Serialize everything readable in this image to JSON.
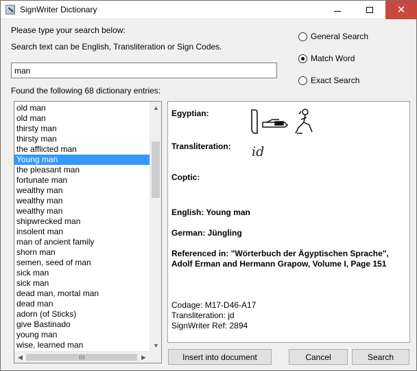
{
  "window": {
    "title": "SignWriter Dictionary"
  },
  "titlebar_buttons": {
    "minimize": "minimize-icon",
    "maximize": "maximize-icon",
    "close": "close-icon"
  },
  "search": {
    "prompt": "Please type your search below:",
    "hint": "Search text can be English, Transliteration or Sign Codes.",
    "value": "man",
    "results_label": "Found the following 68 dictionary entries:"
  },
  "search_modes": [
    {
      "label": "General Search",
      "checked": false
    },
    {
      "label": "Match Word",
      "checked": true
    },
    {
      "label": "Exact Search",
      "checked": false
    }
  ],
  "results": [
    "old man",
    "old man",
    "thirsty man",
    "thirsty man",
    "the afflicted man",
    "Young man",
    "the pleasant man",
    "fortunate man",
    "wealthy man",
    "wealthy man",
    "wealthy man",
    "shipwrecked man",
    "insolent man",
    "man of ancient family",
    "shorn man",
    "semen, seed of man",
    "sick man",
    "sick man",
    "dead man, mortal man",
    "dead man",
    "adorn (of Sticks)",
    "give Bastinado",
    "young man",
    "wise, learned man"
  ],
  "selected_index": 5,
  "detail": {
    "egyptian_label": "Egyptian:",
    "transliteration_label": "Transliteration:",
    "transliteration_glyph": "id",
    "coptic_label": "Coptic:",
    "english": "English: Young man",
    "german": "German: Jüngling",
    "referenced_line1": "Referenced in: \"Wörterbuch der Ägyptischen Sprache\",",
    "referenced_line2": "Adolf Erman and Hermann Grapow, Volume  I, Page 151",
    "codage": "Codage: M17-D46-A17",
    "transliteration": "Transliteration: jd",
    "signwriter_ref": "SignWriter Ref: 2894"
  },
  "buttons": {
    "insert": "Insert into document",
    "cancel": "Cancel",
    "search": "Search"
  },
  "colors": {
    "selection": "#3399ff",
    "close_button": "#c8483f"
  }
}
